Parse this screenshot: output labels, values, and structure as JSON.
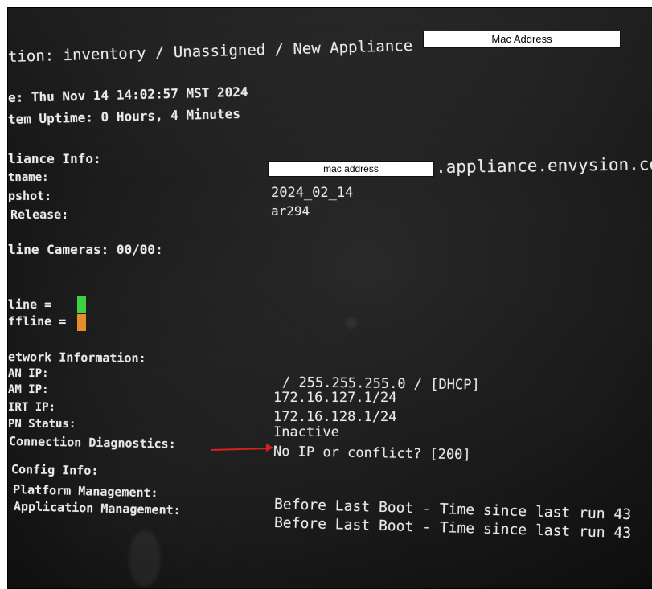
{
  "screen": {
    "location_line": "tion: inventory / Unassigned / New Appliance",
    "date_line": "e: Thu Nov 14 14:02:57 MST 2024",
    "uptime_line": "tem Uptime: 0 Hours, 4 Minutes",
    "appliance_info": {
      "header": "liance Info:",
      "hostname_label": "tname:",
      "snapshot_label": "pshot:",
      "release_label": "Release:",
      "hostname_suffix": ".appliance.envysion.co",
      "snapshot_value": "2024_02_14",
      "release_value": "ar294"
    },
    "cameras_line": "line Cameras: 00/00:",
    "legend": {
      "online_label": "line  =",
      "offline_label": "ffline =",
      "online_color": "#3fd03f",
      "offline_color": "#e3902a"
    },
    "network": {
      "header": "etwork Information:",
      "lan_label": "AN IP:",
      "cam_label": "AM IP:",
      "virt_label": "IRT IP:",
      "vpn_label": "PN Status:",
      "diag_label": "Connection Diagnostics:",
      "cam_value": "/ 255.255.255.0 /  [DHCP]",
      "virt_value": "172.16.127.1/24",
      "vpn_value": "172.16.128.1/24",
      "vpn_status": "Inactive",
      "diag_value": "No IP or conflict? [200]"
    },
    "config": {
      "header": "Config Info:",
      "platform_label": "Platform Management:",
      "application_label": "Application Management:",
      "platform_value": "Before Last Boot - Time since last run 43",
      "application_value": "Before Last Boot - Time since last run 43"
    }
  },
  "annotations": {
    "mac_address_box": "Mac Address",
    "mac_address_box_small": "mac address",
    "arrow_color": "#d8201e"
  }
}
